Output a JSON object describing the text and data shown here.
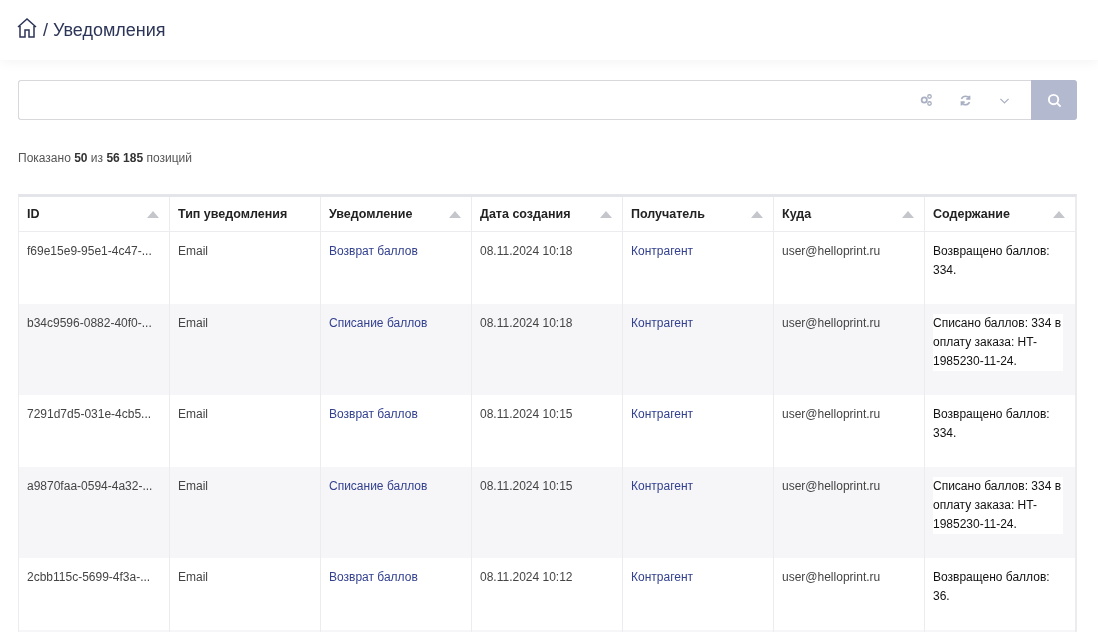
{
  "breadcrumb": {
    "separator": "/",
    "title": "Уведомления"
  },
  "summary": "Показано **50** из **56 185** позиций",
  "table": {
    "columns": [
      {
        "label": "ID",
        "sortable": true
      },
      {
        "label": "Тип уведомления",
        "sortable": false
      },
      {
        "label": "Уведомление",
        "sortable": true
      },
      {
        "label": "Дата создания",
        "sortable": true
      },
      {
        "label": "Получатель",
        "sortable": true
      },
      {
        "label": "Куда",
        "sortable": true
      },
      {
        "label": "Содержание",
        "sortable": true
      }
    ],
    "rows": [
      {
        "id": "f69e15e9-95e1-4c47-...",
        "type": "Email",
        "notification": "Возврат баллов",
        "created": "08.11.2024 10:18",
        "recipient": "Контрагент",
        "to": "user@helloprint.ru",
        "content": "Возвращено баллов: 334."
      },
      {
        "id": "b34c9596-0882-40f0-...",
        "type": "Email",
        "notification": "Списание баллов",
        "created": "08.11.2024 10:18",
        "recipient": "Контрагент",
        "to": "user@helloprint.ru",
        "content": "Списано баллов: 334 в оплату заказа: HT-1985230-11-24."
      },
      {
        "id": "7291d7d5-031e-4cb5...",
        "type": "Email",
        "notification": "Возврат баллов",
        "created": "08.11.2024 10:15",
        "recipient": "Контрагент",
        "to": "user@helloprint.ru",
        "content": "Возвращено баллов: 334."
      },
      {
        "id": "a9870faa-0594-4a32-...",
        "type": "Email",
        "notification": "Списание баллов",
        "created": "08.11.2024 10:15",
        "recipient": "Контрагент",
        "to": "user@helloprint.ru",
        "content": "Списано баллов: 334 в оплату заказа: HT-1985230-11-24."
      },
      {
        "id": "2cbb115c-5699-4f3a-...",
        "type": "Email",
        "notification": "Возврат баллов",
        "created": "08.11.2024 10:12",
        "recipient": "Контрагент",
        "to": "user@helloprint.ru",
        "content": "Возвращено баллов: 36."
      }
    ]
  }
}
